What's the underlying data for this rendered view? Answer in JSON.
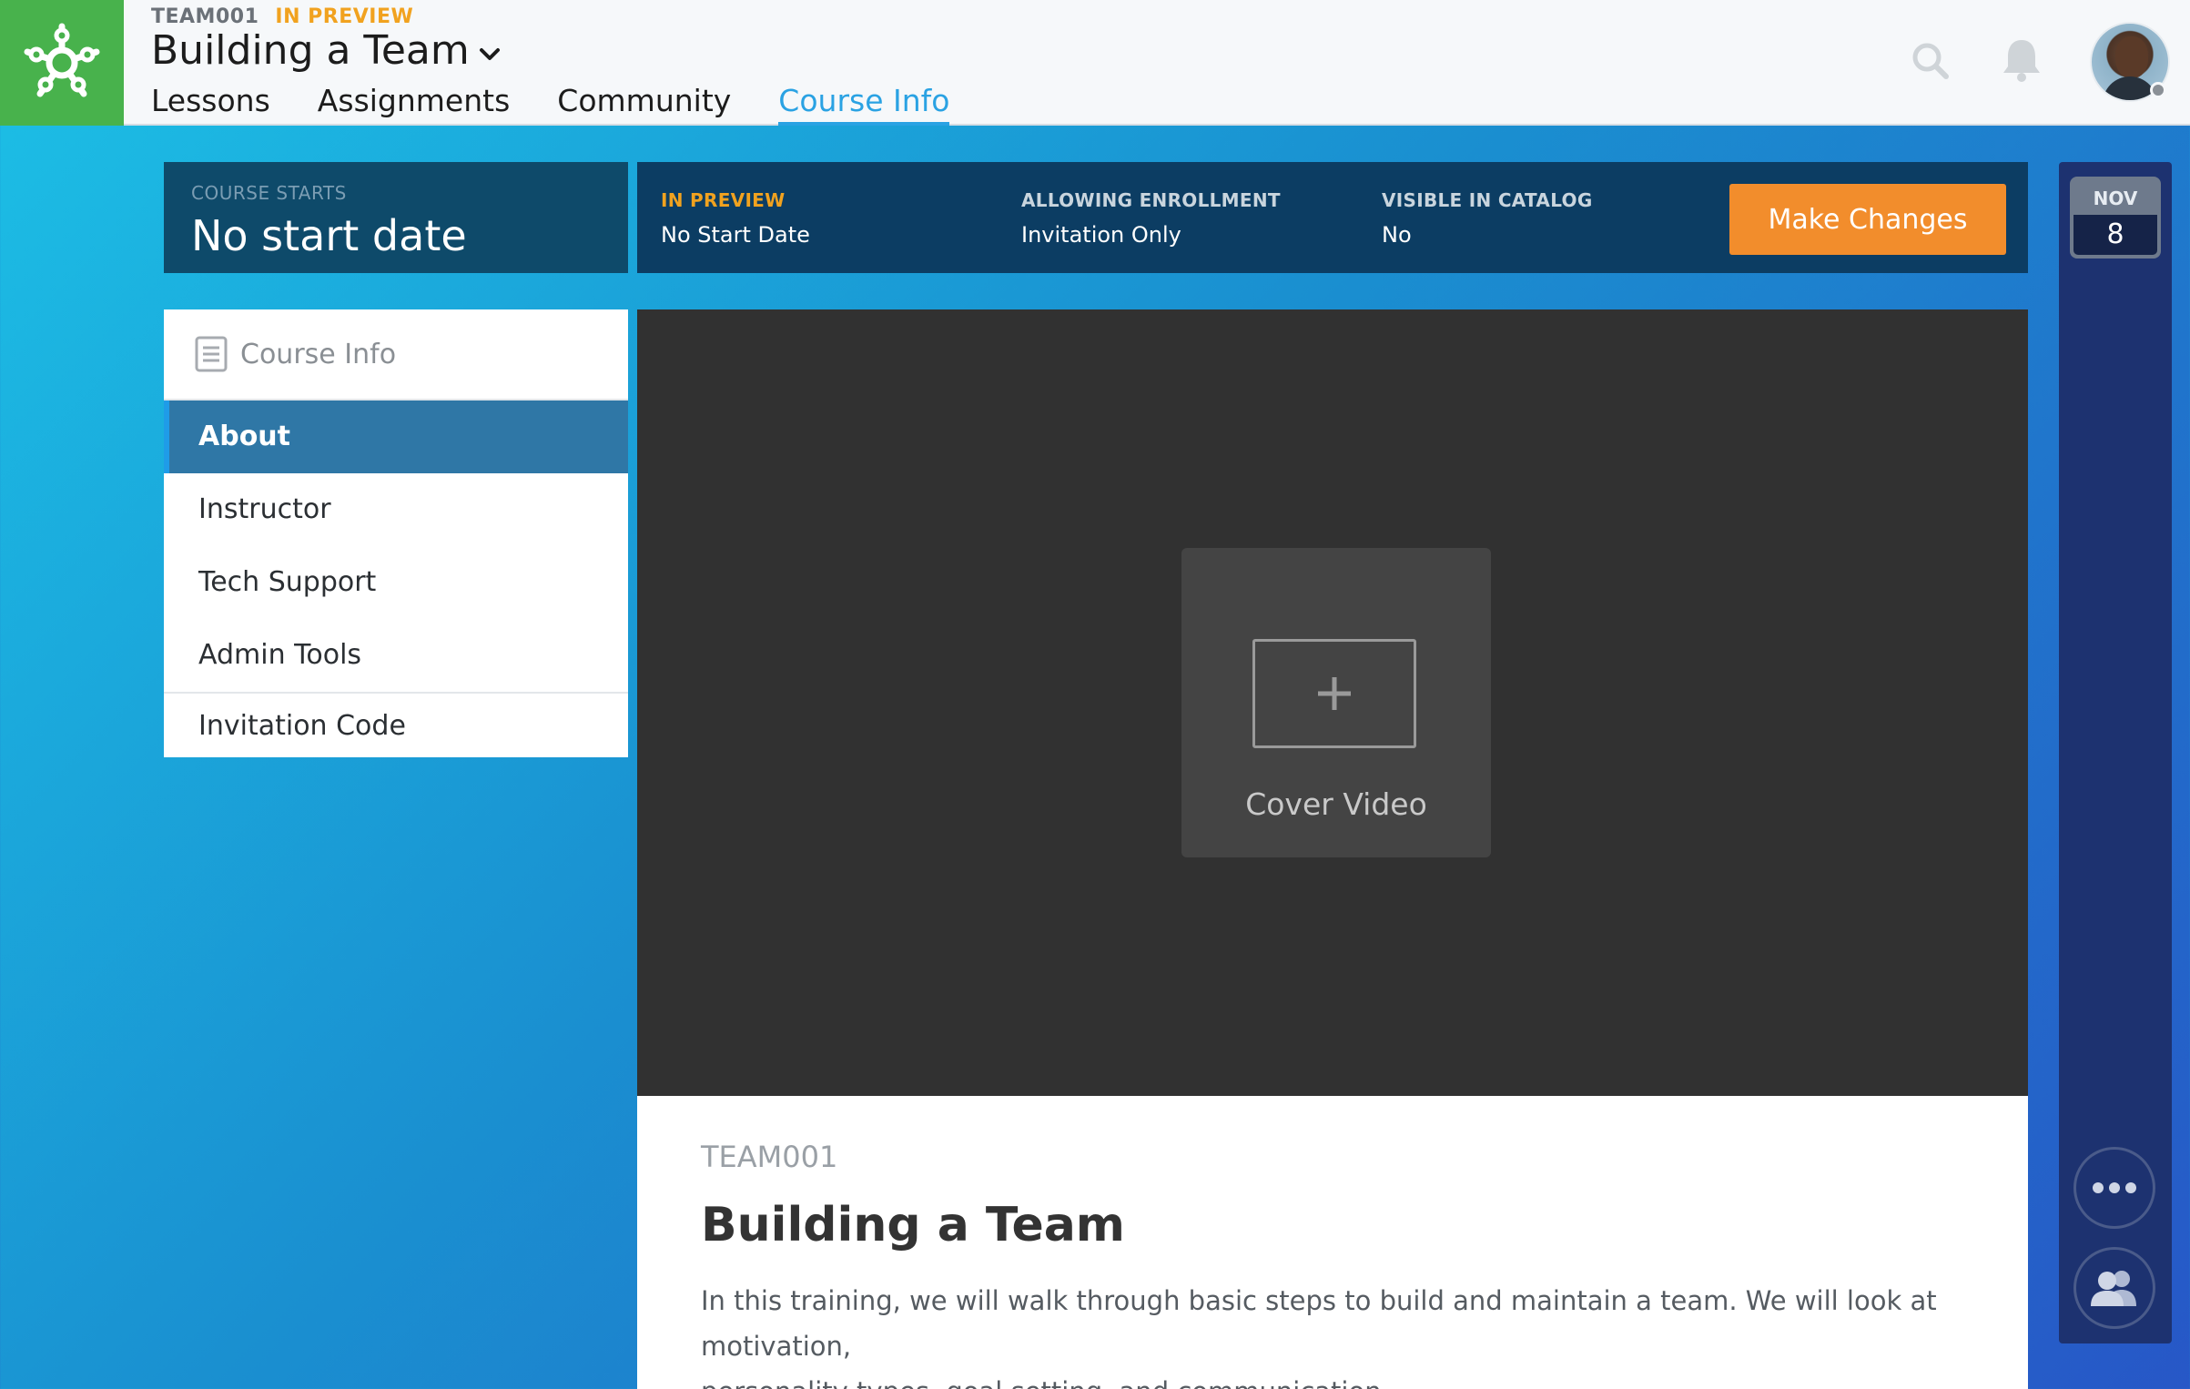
{
  "header": {
    "course_code": "TEAM001",
    "course_status": "IN PREVIEW",
    "course_title": "Building a Team",
    "nav": [
      {
        "label": "Lessons"
      },
      {
        "label": "Assignments"
      },
      {
        "label": "Community"
      },
      {
        "label": "Course Info"
      }
    ],
    "active_nav": "Course Info"
  },
  "status_bar": {
    "course_starts_label": "COURSE STARTS",
    "course_starts_value": "No start date",
    "in_preview_label": "IN PREVIEW",
    "in_preview_value": "No Start Date",
    "enrollment_label": "ALLOWING ENROLLMENT",
    "enrollment_value": "Invitation Only",
    "catalog_label": "VISIBLE IN CATALOG",
    "catalog_value": "No",
    "make_changes_label": "Make Changes"
  },
  "rail": {
    "month": "NOV",
    "day": "8"
  },
  "sidebar": {
    "header": "Course Info",
    "items": [
      {
        "label": "About"
      },
      {
        "label": "Instructor"
      },
      {
        "label": "Tech Support"
      },
      {
        "label": "Admin Tools"
      },
      {
        "label": "Invitation Code"
      }
    ],
    "active": "About"
  },
  "video": {
    "cover_label": "Cover Video"
  },
  "content": {
    "code": "TEAM001",
    "title": "Building a Team",
    "description_line1": "In this training, we will walk through basic steps to build and maintain a team. We will look at motivation,",
    "description_line2": "personality types, goal setting, and communication."
  },
  "colors": {
    "brand_green": "#48b24c",
    "accent_blue": "#2aa2e3",
    "preview_orange": "#f1a21f",
    "button_orange": "#f28d2c",
    "sidebar_active": "#2f77a6"
  }
}
